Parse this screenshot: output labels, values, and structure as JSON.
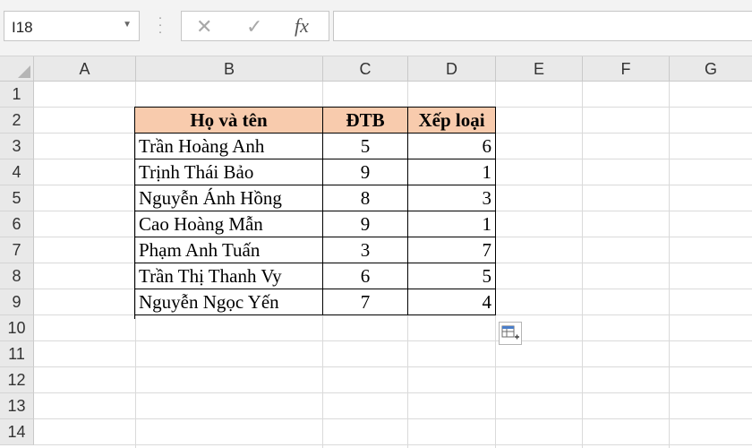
{
  "name_box": {
    "value": "I18"
  },
  "formula": {
    "cancel_icon": "✕",
    "enter_icon": "✓",
    "fx_label": "fx",
    "value": ""
  },
  "columns": [
    "A",
    "B",
    "C",
    "D",
    "E",
    "F",
    "G"
  ],
  "rows": [
    "1",
    "2",
    "3",
    "4",
    "5",
    "6",
    "7",
    "8",
    "9",
    "10",
    "11",
    "12",
    "13",
    "14"
  ],
  "table": {
    "headers": [
      "Họ và tên",
      "ĐTB",
      "Xếp loại"
    ],
    "rows": [
      [
        "Trần Hoàng Anh",
        "5",
        "6"
      ],
      [
        "Trịnh Thái Bảo",
        "9",
        "1"
      ],
      [
        "Nguyễn Ánh Hồng",
        "8",
        "3"
      ],
      [
        "Cao Hoàng Mẫn",
        "9",
        "1"
      ],
      [
        "Phạm Anh Tuấn",
        "3",
        "7"
      ],
      [
        "Trần Thị Thanh Vy",
        "6",
        "5"
      ],
      [
        "Nguyễn Ngọc Yến",
        "7",
        "4"
      ]
    ]
  },
  "colors": {
    "header_fill": "#f8cbad",
    "grid": "#dadada",
    "header_bg": "#e9e9e9"
  },
  "icons": {
    "paste_options": "paste-options-icon"
  }
}
